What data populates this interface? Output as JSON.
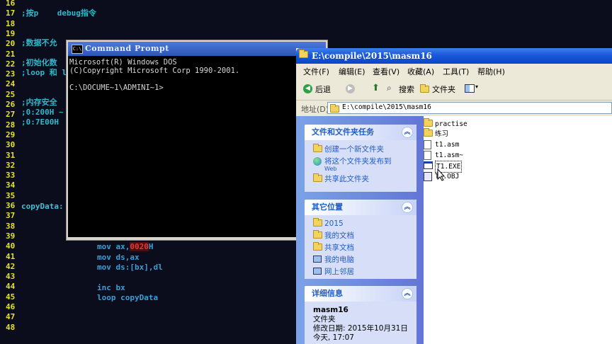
{
  "editor": {
    "line_numbers": [
      "16",
      "17",
      "18",
      "19",
      "20",
      "21",
      "22",
      "23",
      "24",
      "25",
      "26",
      "27",
      "28",
      "29",
      "30",
      "31",
      "32",
      "33",
      "34",
      "35",
      "36",
      "37",
      "38",
      "39",
      "40",
      "41",
      "42",
      "43",
      "44",
      "45",
      "46",
      "47",
      "48"
    ],
    "lines": {
      "l17": ";按p    debug指令",
      "l20": ";数据不允",
      "l22": ";初始化数",
      "l23": ";loop 和 l",
      "l25": ";内存安全",
      "l26": ";0:200H ~",
      "l27": ";0:7E00H",
      "l36": "copyData:",
      "l40a": "mov ax,",
      "l40b": "0020",
      "l40c": "H",
      "l41": "mov ds,ax",
      "l42": "mov ds:[bx],dl",
      "l44": "inc bx",
      "l45": "loop copyData"
    }
  },
  "cmd_window": {
    "icon_text": "C:\\",
    "title": "Command Prompt",
    "lines": [
      "Microsoft(R) Windows DOS",
      "(C)Copyright Microsoft Corp 1990-2001.",
      "",
      "C:\\DOCUME~1\\ADMINI~1>"
    ]
  },
  "explorer": {
    "title": "E:\\compile\\2015\\masm16",
    "menu": [
      "文件(F)",
      "编辑(E)",
      "查看(V)",
      "收藏(A)",
      "工具(T)",
      "帮助(H)"
    ],
    "toolbar": {
      "back": "后退",
      "search": "搜索",
      "folders": "文件夹"
    },
    "address_label": "地址(D)",
    "address_value": "E:\\compile\\2015\\masm16",
    "tasks": {
      "title": "文件和文件夹任务",
      "items": [
        "创建一个新文件夹",
        "将这个文件夹发布到",
        "共享此文件夹"
      ],
      "web_suffix": "Web"
    },
    "other_places": {
      "title": "其它位置",
      "items": [
        "2015",
        "我的文档",
        "共享文档",
        "我的电脑",
        "网上邻居"
      ]
    },
    "details": {
      "title": "详细信息",
      "name": "masm16",
      "type": "文件夹",
      "modified": "修改日期: 2015年10月31日",
      "time": "今天, 17:07"
    },
    "files": [
      "practise",
      "练习",
      "t1.asm",
      "t1.asm~",
      "T1.EXE",
      "T1.OBJ"
    ],
    "chevron": "︽",
    "colors": {
      "title_blue": "#1958d8",
      "task_blue": "#215dc6"
    }
  }
}
